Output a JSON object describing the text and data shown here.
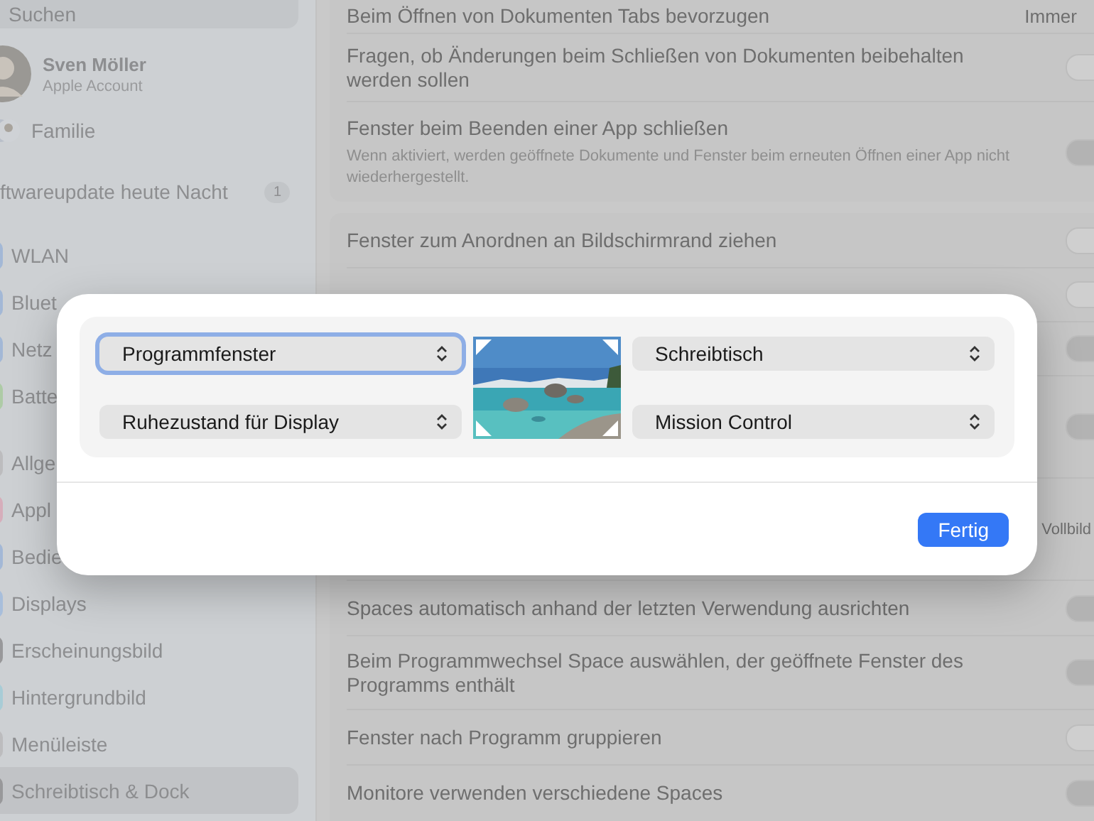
{
  "sidebar": {
    "search": {
      "placeholder": "Suchen"
    },
    "account": {
      "name": "Sven Möller",
      "subtitle": "Apple Account"
    },
    "family": {
      "label": "Familie"
    },
    "update": {
      "label": "ftwareupdate heute Nacht",
      "badge": "1"
    },
    "groups": [
      [
        {
          "label": "WLAN",
          "color": "#a3b8d6",
          "selected": false
        },
        {
          "label": "Bluet",
          "color": "#a3b8d6",
          "selected": false
        },
        {
          "label": "Netz",
          "color": "#a3b8d6",
          "selected": false
        },
        {
          "label": "Batte",
          "color": "#aecba6",
          "selected": false
        }
      ],
      [
        {
          "label": "Allge",
          "color": "#bcbcbe",
          "selected": false
        },
        {
          "label": "Appl",
          "color": "#d6aebb",
          "selected": false
        },
        {
          "label": "Bedie",
          "color": "#a3b8d6",
          "selected": false
        },
        {
          "label": "Displays",
          "color": "#a8bedb",
          "selected": false
        },
        {
          "label": "Erscheinungsbild",
          "color": "#98989a",
          "selected": false
        },
        {
          "label": "Hintergrundbild",
          "color": "#a8ccd6",
          "selected": false
        },
        {
          "label": "Menüleiste",
          "color": "#bcbcbe",
          "selected": false
        },
        {
          "label": "Schreibtisch & Dock",
          "color": "#98989a",
          "selected": true
        }
      ]
    ]
  },
  "settings": [
    [
      {
        "kind": "popup",
        "label": "Beim Öffnen von Dokumenten Tabs bevorzugen",
        "value": "Immer"
      },
      {
        "kind": "toggle",
        "label": "Fragen, ob Änderungen beim Schließen von Dokumenten beibehalten werden sollen",
        "on": false
      },
      {
        "kind": "toggle",
        "label": "Fenster beim Beenden einer App schließen",
        "description": "Wenn aktiviert, werden geöffnete Dokumente und Fenster beim erneuten Öffnen einer App nicht wiederhergestellt.",
        "on": true
      }
    ],
    [
      {
        "kind": "toggle",
        "label": "Fenster zum Anordnen an Bildschirmrand ziehen",
        "on": false
      },
      {
        "kind": "covered",
        "on": false
      },
      {
        "kind": "covered",
        "on": true
      },
      {
        "kind": "covered",
        "on": true
      },
      {
        "kind": "covered-tail",
        "tail": "Vollbild"
      },
      {
        "kind": "toggle",
        "label": "Spaces automatisch anhand der letzten Verwendung ausrichten",
        "on": true
      },
      {
        "kind": "toggle",
        "label": "Beim Programmwechsel Space auswählen, der geöffnete Fenster des Programms enthält",
        "on": true
      },
      {
        "kind": "toggle",
        "label": "Fenster nach Programm gruppieren",
        "on": false
      },
      {
        "kind": "toggle",
        "label": "Monitore verwenden verschiedene Spaces",
        "on": true
      }
    ]
  ],
  "dialog": {
    "corners": [
      {
        "label": "Programmfenster",
        "focused": true
      },
      {
        "label": "Schreibtisch",
        "focused": false
      },
      {
        "label": "Ruhezustand für Display",
        "focused": false
      },
      {
        "label": "Mission Control",
        "focused": false
      }
    ],
    "done_button": "Fertig"
  }
}
